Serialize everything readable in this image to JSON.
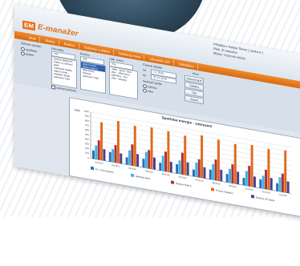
{
  "app": {
    "logo_mark": "EM",
    "logo_text": "E-manažer"
  },
  "user_info": {
    "line1": "Přihlášen: Radek Šebor [ správce ]",
    "line2": "Role: E-manažer",
    "line3": "Město: Vzorové město"
  },
  "menu": [
    "Moje",
    "Sklady",
    "Budovy",
    "Dodávky a platby",
    "Odběrná místa",
    "Uživatelé sítě",
    "Odhlášení"
  ],
  "toolbar": {
    "type_label": "Způsob výpočtu",
    "type_options": [
      "spotřeba",
      "platba"
    ],
    "commodity_label": "Komodita",
    "commodity_value": "Vše",
    "buildings_label": "Budovy",
    "buildings_value": "Vše",
    "buildings_list": [
      "správa obecních",
      "budov a zařízení",
      "jesle",
      "mateřská školka",
      "obecní úřad",
      "základní škola",
      "sportovní hala"
    ],
    "sites_label": "Odb. místa",
    "sites_value": "Vše",
    "sites_list": [
      "obecní úřad",
      "školní jídelna",
      "tělocvična",
      "kotelna",
      "sportovní hala"
    ],
    "sites2_label": "Odběrná místa",
    "sites2_list": [
      "voda - sport. hala",
      "plyn - tělocvična",
      "elektřina - OÚ",
      "plyn - kotelna"
    ],
    "interval_label": "Časové období",
    "date_from_label": "od",
    "date_from": "1.1.2010",
    "date_to_label": "do",
    "date_to": "31.12.2010",
    "grouping_label": "Seskupit podle",
    "grouping_options": [
      "měsíce",
      "roku"
    ],
    "agg_label": "Agregace",
    "column_header": "Akce",
    "checkbox_label": "zobrazit průměr",
    "buttons": [
      "Zobrazit graf",
      "Tabulka",
      "Tisk",
      "Export"
    ]
  },
  "colors": {
    "menu": "#e86f1a",
    "series": [
      "#2d6db5",
      "#39b5e6",
      "#b03030",
      "#e06a1c",
      "#4a3f8f"
    ]
  },
  "chart_data": {
    "type": "bar",
    "title": "Spotřeba energie - zobrazení",
    "ylabel": "kWh",
    "categories": [
      "01/2010",
      "02/2010",
      "03/2010",
      "04/2010",
      "05/2010",
      "06/2010",
      "07/2010",
      "08/2010",
      "09/2010",
      "10/2010",
      "11/2010",
      "12/2010"
    ],
    "ylim": [
      0,
      1000
    ],
    "yticks": [
      "1000",
      "900",
      "800",
      "700",
      "600",
      "500",
      "400",
      "300",
      "200",
      "100",
      "0"
    ],
    "series": [
      {
        "name": "El. v Komunálnici",
        "values": [
          180,
          210,
          160,
          190,
          170,
          200,
          150,
          210,
          180,
          160,
          190,
          170
        ]
      },
      {
        "name": "Městský úřad",
        "values": [
          300,
          280,
          320,
          350,
          330,
          290,
          310,
          340,
          300,
          320,
          280,
          310
        ]
      },
      {
        "name": "Budova Hala A",
        "values": [
          420,
          380,
          460,
          400,
          430,
          470,
          390,
          450,
          410,
          440,
          420,
          400
        ]
      },
      {
        "name": "Provoz Základní",
        "values": [
          820,
          910,
          870,
          900,
          880,
          850,
          920,
          890,
          860,
          900,
          880,
          910
        ]
      },
      {
        "name": "Budova ZŠ Sokol",
        "values": [
          250,
          220,
          270,
          260,
          230,
          280,
          240,
          250,
          270,
          230,
          260,
          250
        ]
      }
    ]
  }
}
